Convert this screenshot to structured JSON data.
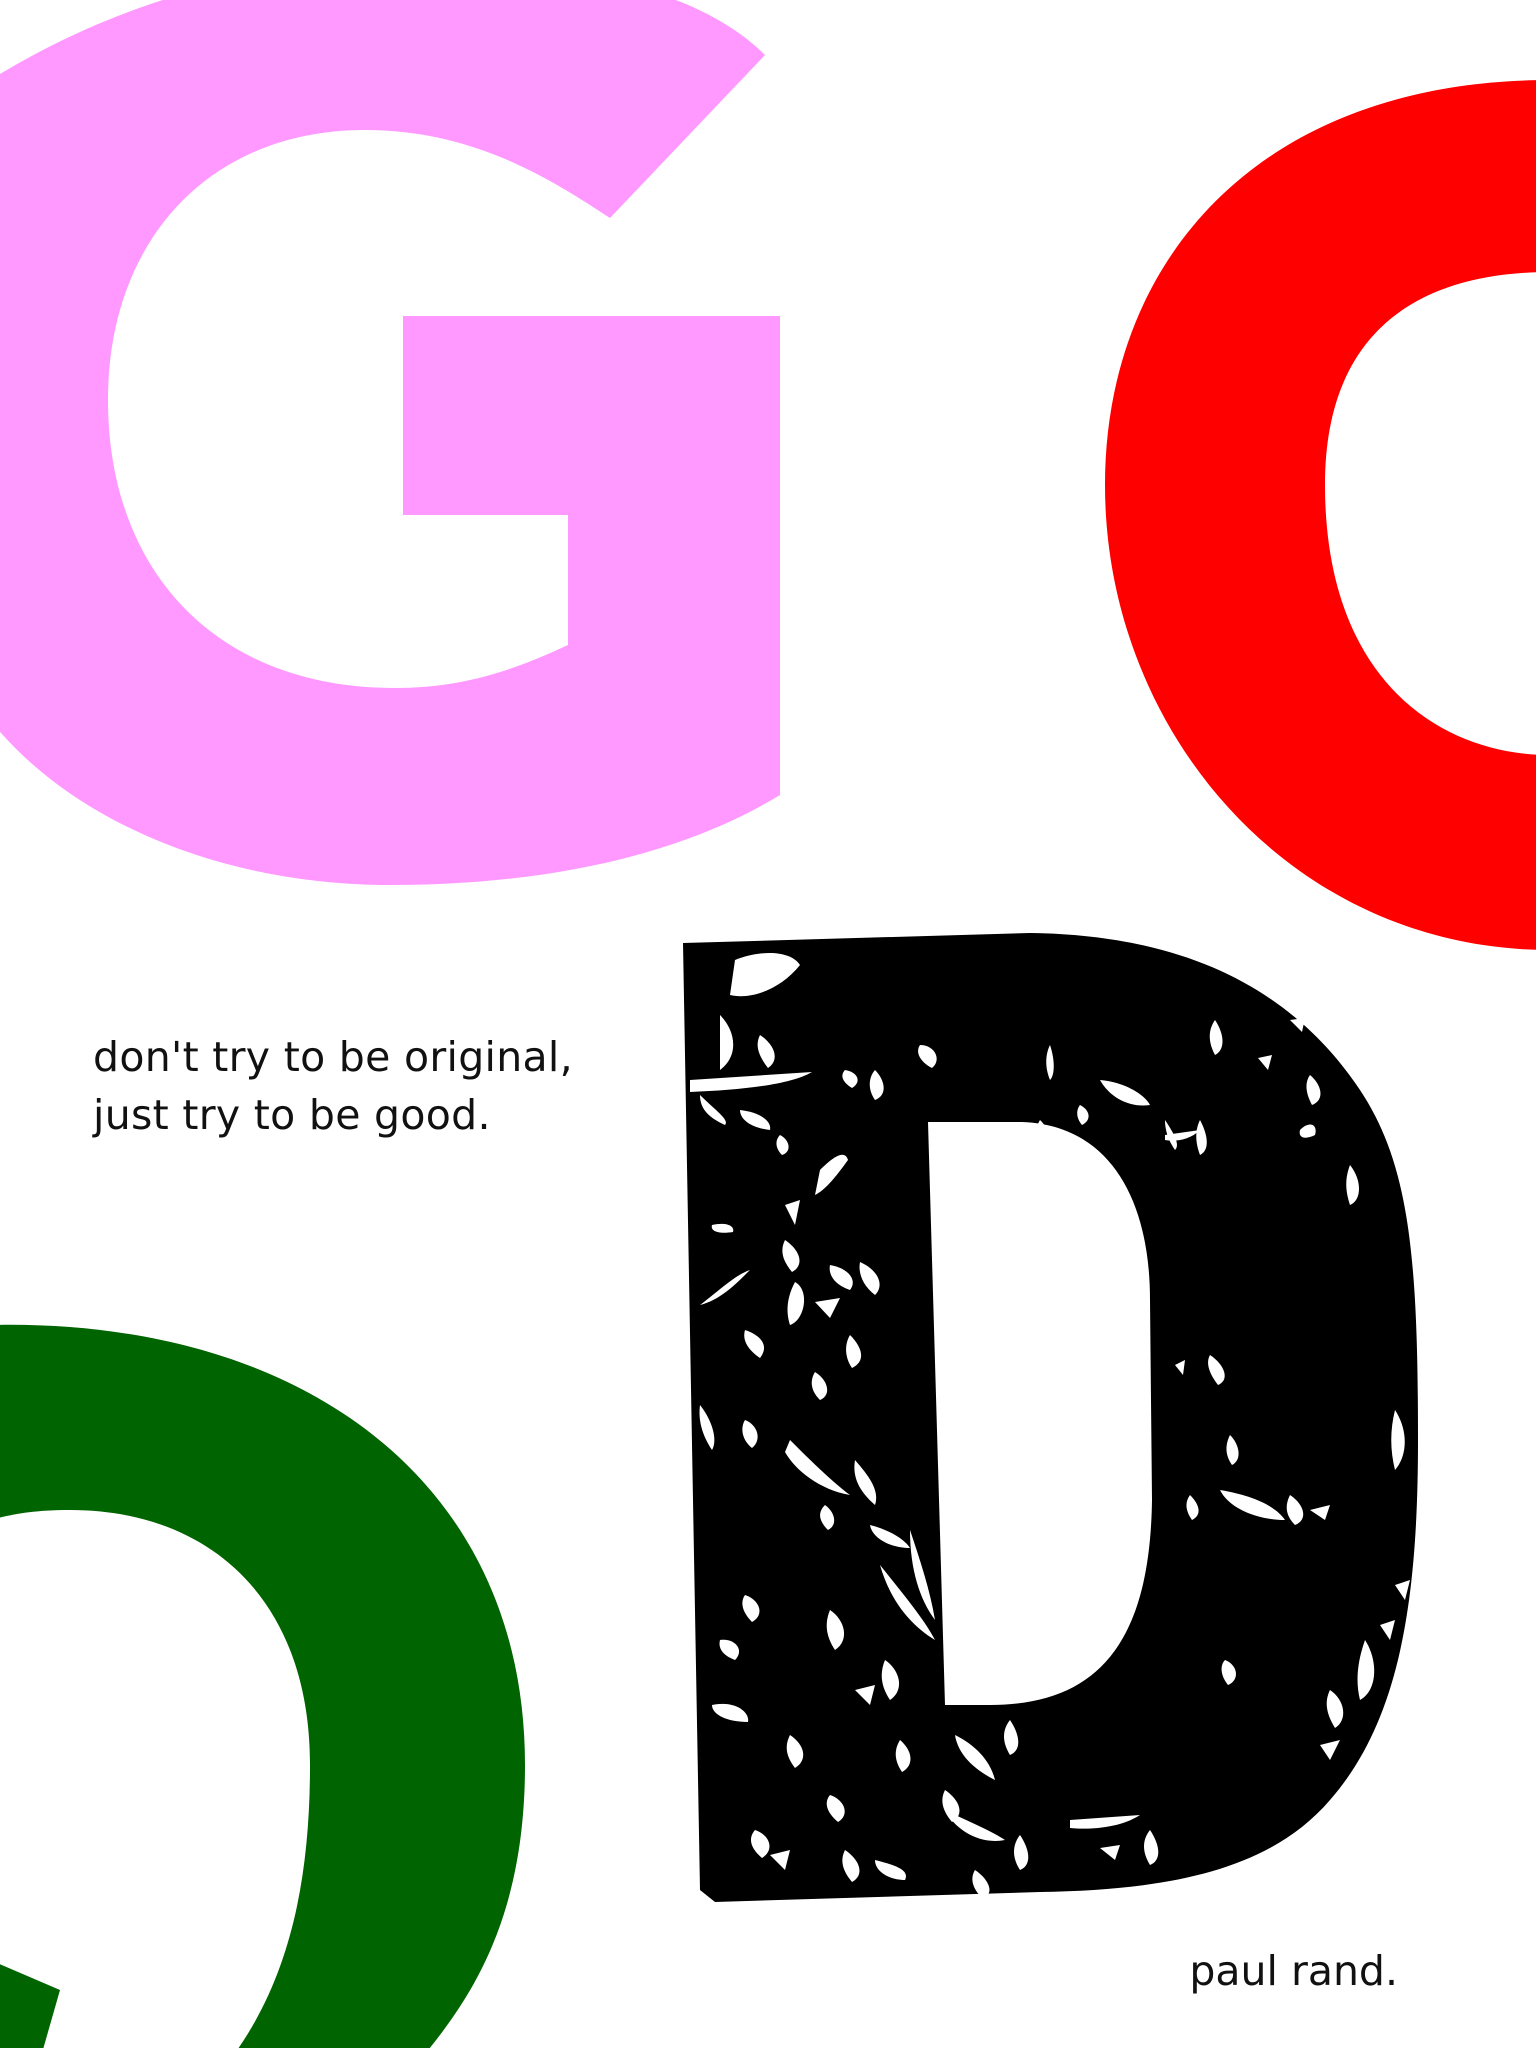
{
  "quote": {
    "line1": "don't try to be original,",
    "line2": "just try to be good."
  },
  "author": "paul rand.",
  "letters": {
    "g": {
      "char": "G",
      "color": "#ff99ff"
    },
    "o_top": {
      "char": "O",
      "color": "#ff0000"
    },
    "o_bottom": {
      "char": "O",
      "color": "#006400"
    },
    "d": {
      "char": "D",
      "color": "#000000",
      "texture": "distressed"
    }
  },
  "background": "#ffffff"
}
